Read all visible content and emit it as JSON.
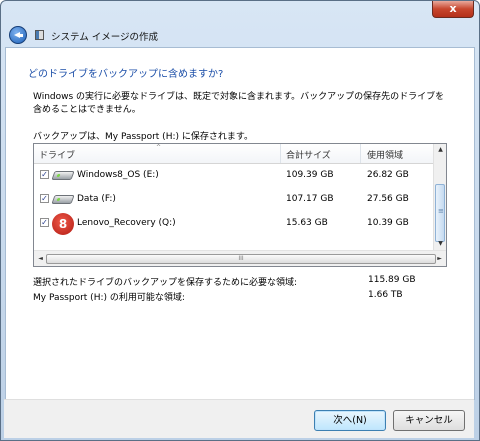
{
  "window": {
    "close_glyph": "x",
    "title": "システム イメージの作成"
  },
  "page": {
    "question": "どのドライブをバックアップに含めますか?",
    "description": "Windows の実行に必要なドライブは、既定で対象に含まれます。バックアップの保存先のドライブを含めることはできません。",
    "saved_to": "バックアップは、My Passport (H:) に保存されます。"
  },
  "list": {
    "columns": [
      "ドライブ",
      "合計サイズ",
      "使用領域"
    ],
    "rows": [
      {
        "checked": true,
        "icon": "hard-drive-icon",
        "name": "Windows8_OS (E:)",
        "total": "109.39 GB",
        "used": "26.82 GB"
      },
      {
        "checked": true,
        "icon": "hard-drive-icon",
        "name": "Data (F:)",
        "total": "107.17 GB",
        "used": "27.56 GB"
      },
      {
        "checked": true,
        "icon": "lenovo-recovery-icon",
        "name": "Lenovo_Recovery (Q:)",
        "total": "15.63 GB",
        "used": "10.39 GB"
      }
    ],
    "check_glyph": "✓",
    "lenovo_glyph": "8",
    "sort_glyph": "^",
    "scroll": {
      "up": "▲",
      "down": "▼",
      "left": "◄",
      "right": "►",
      "grip": "≡",
      "hgrip": "III"
    }
  },
  "summary": {
    "required_label": "選択されたドライブのバックアップを保存するために必要な領域:",
    "required_value": "115.89 GB",
    "available_label": "My Passport (H:) の利用可能な領域:",
    "available_value": "1.66 TB"
  },
  "footer": {
    "next_label": "次へ(N)",
    "cancel_label": "キャンセル"
  }
}
